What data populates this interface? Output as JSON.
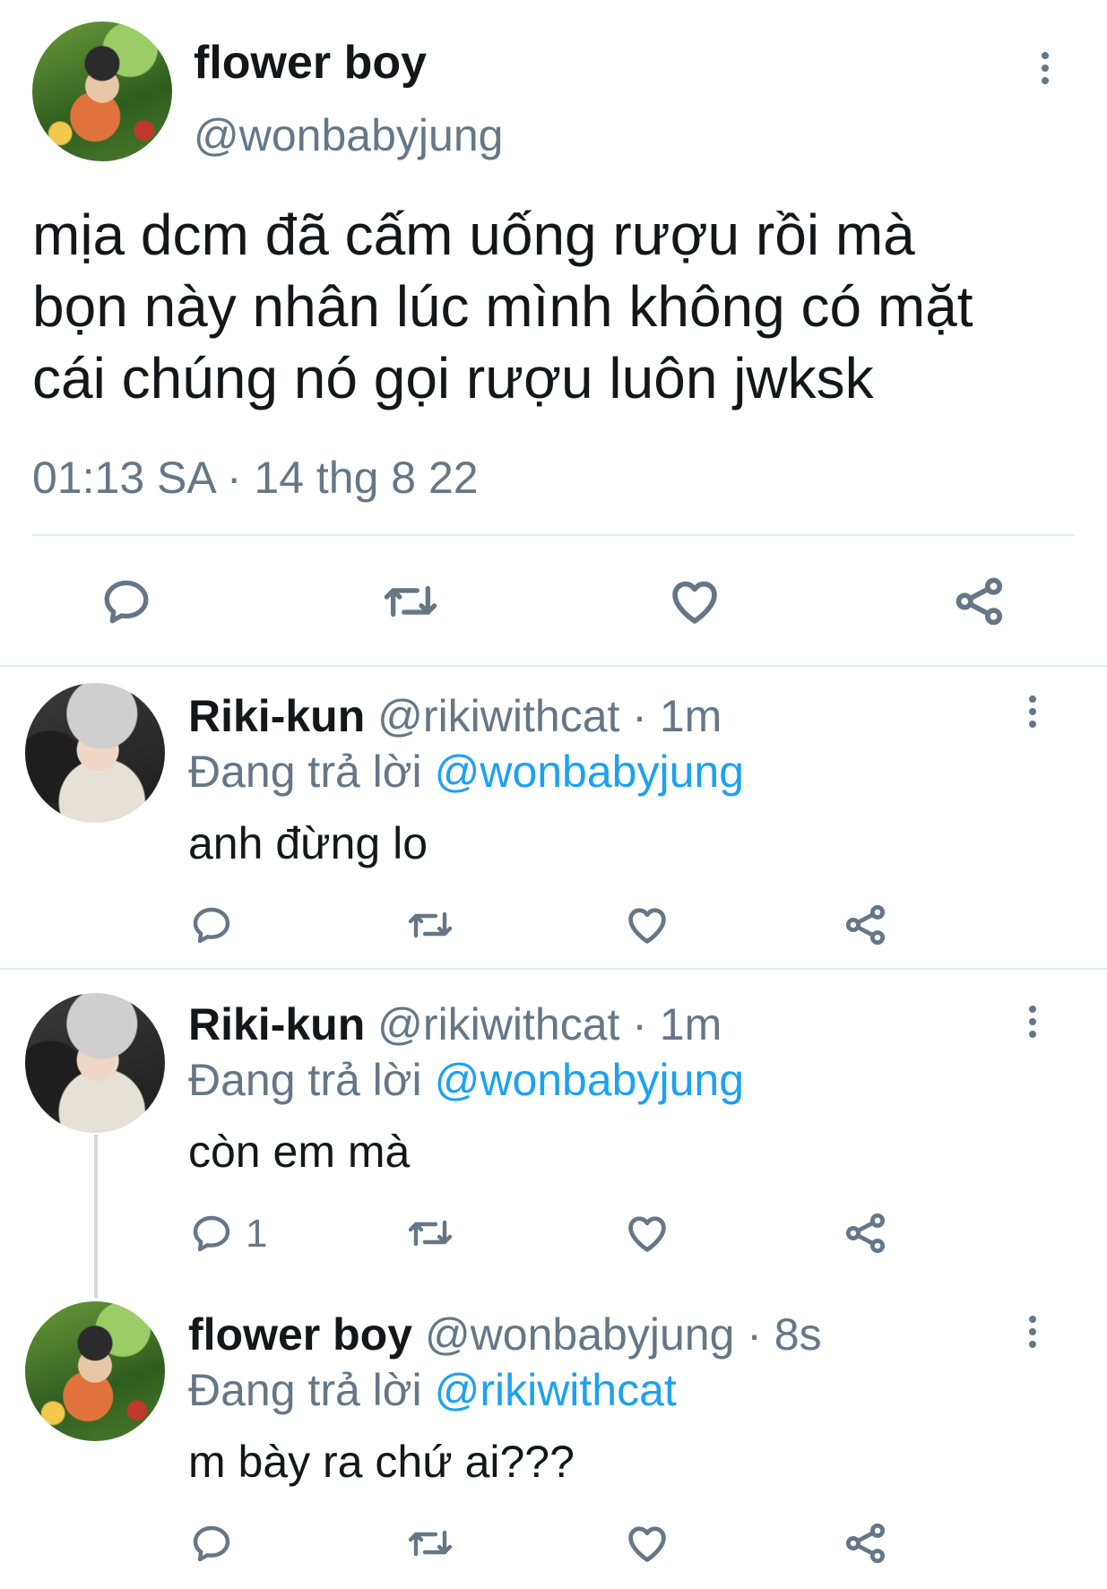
{
  "main_tweet": {
    "display_name": "flower boy",
    "handle": "@wonbabyjung",
    "text_lines": [
      "mịa dcm đã cấm uống rượu rồi mà",
      "bọn này nhân lúc mình không có mặt",
      "cái chúng nó gọi rượu luôn jwksk"
    ],
    "timestamp": "01:13 SA · 14 thg 8 22"
  },
  "replies": [
    {
      "display_name": "Riki-kun",
      "meta": "@rikiwithcat · 1m",
      "replying_prefix": "Đang trả lời",
      "replying_to": "@wonbabyjung",
      "text": "anh đừng lo",
      "reply_count": ""
    },
    {
      "display_name": "Riki-kun",
      "meta": "@rikiwithcat · 1m",
      "replying_prefix": "Đang trả lời",
      "replying_to": "@wonbabyjung",
      "text": "còn em mà",
      "reply_count": "1"
    },
    {
      "display_name": "flower boy",
      "meta": "@wonbabyjung · 8s",
      "replying_prefix": "Đang trả lời",
      "replying_to": "@rikiwithcat",
      "text": "m bày ra chứ ai???",
      "reply_count": ""
    }
  ],
  "icons": [
    "comment-icon",
    "retweet-icon",
    "like-icon",
    "share-icon",
    "more-options-icon"
  ],
  "colors": {
    "link": "#1da1f2",
    "muted": "#657786",
    "divider": "#e6ecf0"
  }
}
